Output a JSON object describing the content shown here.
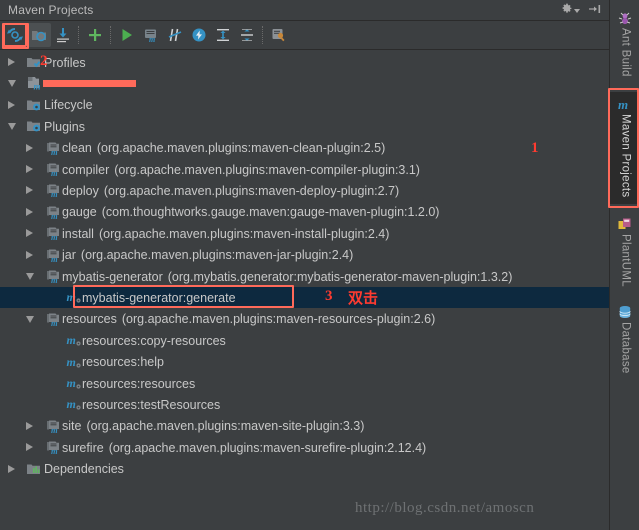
{
  "window": {
    "title": "Maven Projects",
    "header_icons": [
      {
        "name": "gear-icon",
        "label": "Settings"
      },
      {
        "name": "hide-icon",
        "label": "Hide"
      }
    ]
  },
  "toolbar": {
    "buttons": [
      {
        "name": "reimport-icon",
        "label": "Reimport All Maven Projects",
        "highlighted": true
      },
      {
        "name": "generate-sources-icon",
        "label": "Generate Sources and Update Folders",
        "highlighted": false
      },
      {
        "name": "download-sources-icon",
        "label": "Download Sources and/or Documentation",
        "highlighted": false
      },
      {
        "name": "add-icon",
        "label": "Add Maven Projects",
        "highlighted": false
      },
      {
        "name": "run-icon",
        "label": "Run Maven Build",
        "highlighted": false
      },
      {
        "name": "execute-goal-icon",
        "label": "Execute Maven Goal",
        "highlighted": false
      },
      {
        "name": "skip-tests-icon",
        "label": "Toggle Skip Tests Mode",
        "highlighted": false
      },
      {
        "name": "offline-icon",
        "label": "Toggle Offline Mode",
        "highlighted": false
      },
      {
        "name": "expand-all-icon",
        "label": "Expand All",
        "highlighted": false
      },
      {
        "name": "collapse-all-icon",
        "label": "Collapse All",
        "highlighted": false
      },
      {
        "name": "maven-settings-icon",
        "label": "Maven Settings",
        "highlighted": false
      }
    ]
  },
  "tree": {
    "rows": [
      {
        "depth": 0,
        "toggle": "right",
        "icon": "profiles-icon",
        "label": "Profiles",
        "detail": "",
        "selected": false
      },
      {
        "depth": 0,
        "toggle": "down",
        "icon": "maven-module-icon",
        "label": "",
        "detail": "",
        "selected": false,
        "redacted": true
      },
      {
        "depth": 1,
        "toggle": "right",
        "icon": "lifecycle-icon",
        "label": "Lifecycle",
        "detail": "",
        "selected": false
      },
      {
        "depth": 1,
        "toggle": "down",
        "icon": "plugins-icon",
        "label": "Plugins",
        "detail": "",
        "selected": false
      },
      {
        "depth": 2,
        "toggle": "right",
        "icon": "plugin-icon",
        "label": "clean",
        "detail": "(org.apache.maven.plugins:maven-clean-plugin:2.5)",
        "selected": false
      },
      {
        "depth": 2,
        "toggle": "right",
        "icon": "plugin-icon",
        "label": "compiler",
        "detail": "(org.apache.maven.plugins:maven-compiler-plugin:3.1)",
        "selected": false
      },
      {
        "depth": 2,
        "toggle": "right",
        "icon": "plugin-icon",
        "label": "deploy",
        "detail": "(org.apache.maven.plugins:maven-deploy-plugin:2.7)",
        "selected": false
      },
      {
        "depth": 2,
        "toggle": "right",
        "icon": "plugin-icon",
        "label": "gauge",
        "detail": "(com.thoughtworks.gauge.maven:gauge-maven-plugin:1.2.0)",
        "selected": false
      },
      {
        "depth": 2,
        "toggle": "right",
        "icon": "plugin-icon",
        "label": "install",
        "detail": "(org.apache.maven.plugins:maven-install-plugin:2.4)",
        "selected": false
      },
      {
        "depth": 2,
        "toggle": "right",
        "icon": "plugin-icon",
        "label": "jar",
        "detail": "(org.apache.maven.plugins:maven-jar-plugin:2.4)",
        "selected": false
      },
      {
        "depth": 2,
        "toggle": "down",
        "icon": "plugin-icon",
        "label": "mybatis-generator",
        "detail": "(org.mybatis.generator:mybatis-generator-maven-plugin:1.3.2)",
        "selected": false
      },
      {
        "depth": 3,
        "toggle": "none",
        "icon": "goal-icon",
        "label": "mybatis-generator:generate",
        "detail": "",
        "selected": true
      },
      {
        "depth": 2,
        "toggle": "down",
        "icon": "plugin-icon",
        "label": "resources",
        "detail": "(org.apache.maven.plugins:maven-resources-plugin:2.6)",
        "selected": false
      },
      {
        "depth": 3,
        "toggle": "none",
        "icon": "goal-icon",
        "label": "resources:copy-resources",
        "detail": "",
        "selected": false
      },
      {
        "depth": 3,
        "toggle": "none",
        "icon": "goal-icon",
        "label": "resources:help",
        "detail": "",
        "selected": false
      },
      {
        "depth": 3,
        "toggle": "none",
        "icon": "goal-icon",
        "label": "resources:resources",
        "detail": "",
        "selected": false
      },
      {
        "depth": 3,
        "toggle": "none",
        "icon": "goal-icon",
        "label": "resources:testResources",
        "detail": "",
        "selected": false
      },
      {
        "depth": 2,
        "toggle": "right",
        "icon": "plugin-icon",
        "label": "site",
        "detail": "(org.apache.maven.plugins:maven-site-plugin:3.3)",
        "selected": false
      },
      {
        "depth": 2,
        "toggle": "right",
        "icon": "plugin-icon",
        "label": "surefire",
        "detail": "(org.apache.maven.plugins:maven-surefire-plugin:2.12.4)",
        "selected": false
      },
      {
        "depth": 1,
        "toggle": "right",
        "icon": "dependencies-icon",
        "label": "Dependencies",
        "detail": "",
        "selected": false
      }
    ]
  },
  "right_tool_bar": {
    "tabs": [
      {
        "name": "ant-build",
        "label": "Ant Build",
        "icon": "ant-icon",
        "active": false,
        "highlighted": false
      },
      {
        "name": "maven-projects",
        "label": "Maven Projects",
        "icon": "maven-m-icon",
        "active": true,
        "highlighted": true
      },
      {
        "name": "plantuml",
        "label": "PlantUML",
        "icon": "plantuml-icon",
        "active": false,
        "highlighted": false
      },
      {
        "name": "database",
        "label": "Database",
        "icon": "database-icon",
        "active": false,
        "highlighted": false
      }
    ]
  },
  "annotations": {
    "marker_1": "1",
    "marker_2": "2",
    "marker_3": "3",
    "marker_3_text": "双击",
    "accent_color": "#ff6a5a",
    "number_color": "#ff3b30"
  },
  "watermark": {
    "text": "http://blog.csdn.net/amoscn"
  }
}
